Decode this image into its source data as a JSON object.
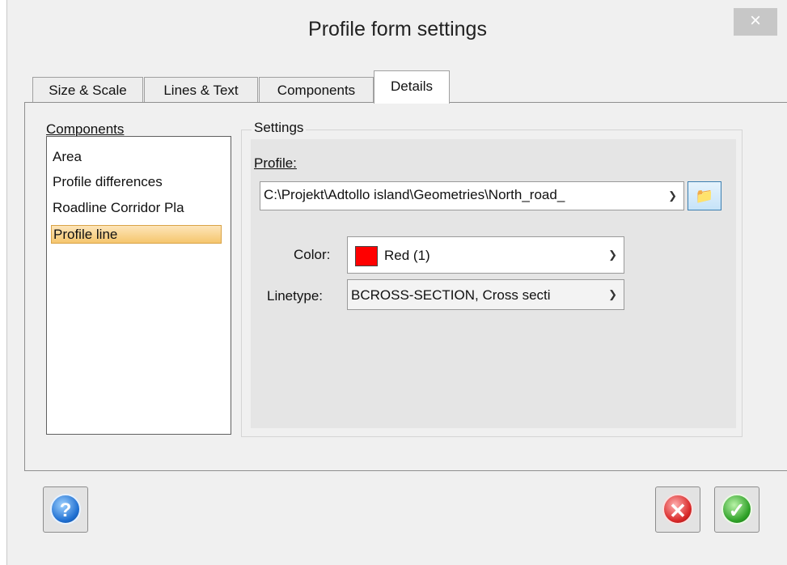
{
  "window": {
    "title": "Profile form settings",
    "close_glyph": "×"
  },
  "tabs": [
    {
      "label": "Size & Scale",
      "active": false
    },
    {
      "label": "Lines & Text",
      "active": false
    },
    {
      "label": "Components",
      "active": false
    },
    {
      "label": "Details",
      "active": true
    }
  ],
  "components": {
    "label": "Components",
    "items": [
      "Area",
      "Profile differences",
      "Roadline Corridor Pla",
      "Profile line"
    ],
    "selected": "Profile line"
  },
  "settings": {
    "group_label": "Settings",
    "profile_label": "Profile:",
    "profile_value": "C:\\Projekt\\Adtollo island\\Geometries\\North_road_",
    "color_label": "Color:",
    "color_value": "Red (1)",
    "color_swatch": "#ff0000",
    "linetype_label": "Linetype:",
    "linetype_value": "BCROSS-SECTION, Cross secti"
  },
  "icons": {
    "help": "help-icon",
    "cancel": "cancel-icon",
    "ok": "ok-icon",
    "browse": "folder-icon",
    "dropdown": "chevron-down-icon"
  },
  "colors": {
    "selection_fill": "#f5c66e",
    "help_blue": "#1f6fd1",
    "cancel_red": "#d82727",
    "ok_green": "#2ea127"
  }
}
